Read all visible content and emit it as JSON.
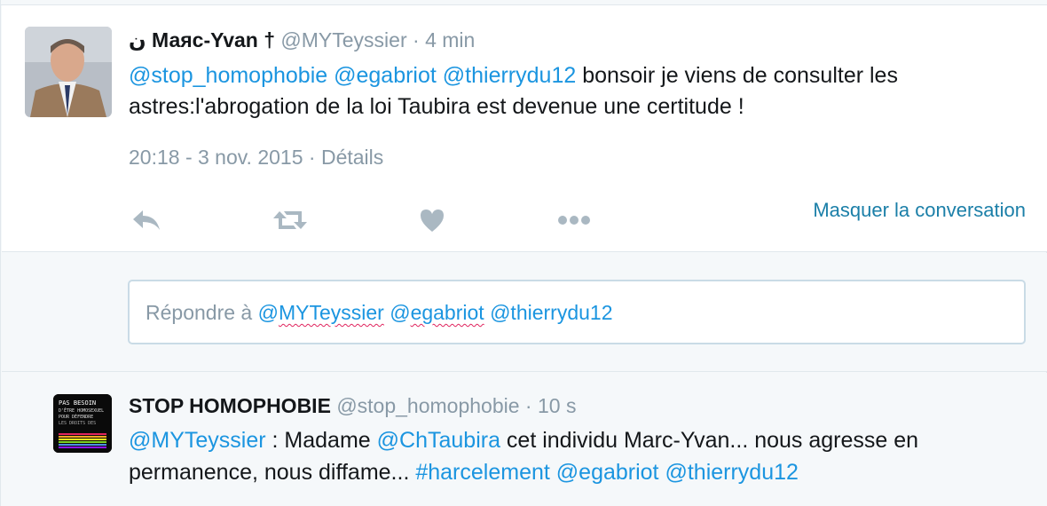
{
  "tweet": {
    "fullname": "ن Маяс-Yvan †",
    "handle": "@MYTeyssier",
    "separator": " · ",
    "time_ago": "4 min",
    "mention1": "@stop_homophobie",
    "mention2": "@egabriot",
    "mention3": "@thierrydu12",
    "text": " bonsoir je viens de consulter les astres:l'abrogation de la loi Taubira est devenue une certitude !",
    "timestamp": "20:18 - 3 nov. 2015",
    "details_label": "Détails",
    "hide_conversation": "Masquer la conversation",
    "icons": [
      "reply-icon",
      "retweet-icon",
      "like-icon",
      "more-icon"
    ]
  },
  "reply": {
    "placeholder": "Répondre à ",
    "mention1": "@MYTeyssier",
    "mention2": "@egabriot",
    "mention3": "@thierrydu12"
  },
  "reply_tweet": {
    "fullname": "STOP HOMOPHOBIE",
    "handle": "@stop_homophobie",
    "time_ago": "10 s",
    "mention1": "@MYTeyssier",
    "text1": " : Madame ",
    "mention2": "@ChTaubira",
    "text2": " cet individu Marc-Yvan... nous agresse en permanence, nous diffame...  ",
    "hashtag": "#harcelement",
    "mention3": "@egabriot",
    "mention4": "@thierrydu12",
    "avatar_text": "PAS BESOIN D'ÊTRE HOMOSEXUEL POUR DÉFENDRE LES DROITS DES"
  },
  "colors": {
    "link": "#1b95e0",
    "muted": "#8899a6",
    "action_icon": "#aab8c2",
    "conversation_link": "#1b7fa8"
  }
}
